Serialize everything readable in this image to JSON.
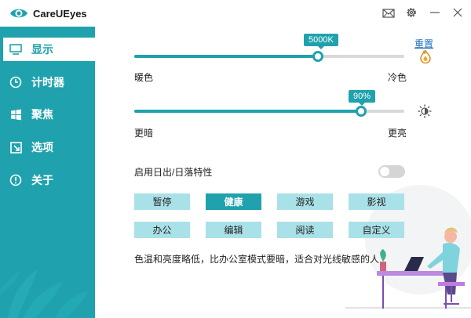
{
  "app": {
    "title": "CareUEyes"
  },
  "colors": {
    "accent": "#1fa2ad",
    "sidebar": "#1fa2ad",
    "button_bg": "#a9e1e8",
    "link": "#1a6fbf"
  },
  "titlebar_icons": [
    "mail-icon",
    "gear-icon",
    "minimize-icon",
    "close-icon"
  ],
  "sidebar": {
    "items": [
      {
        "label": "显示",
        "icon": "monitor-icon",
        "active": true
      },
      {
        "label": "计时器",
        "icon": "clock-icon",
        "active": false
      },
      {
        "label": "聚焦",
        "icon": "windows-icon",
        "active": false
      },
      {
        "label": "选项",
        "icon": "external-link-icon",
        "active": false
      },
      {
        "label": "关于",
        "icon": "info-icon",
        "active": false
      }
    ]
  },
  "display": {
    "reset_label": "重置",
    "temperature": {
      "value_text": "5000K",
      "min_label": "暖色",
      "max_label": "冷色",
      "level": 0.68,
      "icon": "flame-icon"
    },
    "brightness": {
      "value_text": "90%",
      "min_label": "更暗",
      "max_label": "更亮",
      "level": 0.84,
      "icon": "brightness-icon"
    },
    "sunset": {
      "label": "启用日出/日落特性",
      "enabled": false
    },
    "modes": [
      {
        "label": "暂停",
        "selected": false
      },
      {
        "label": "健康",
        "selected": true
      },
      {
        "label": "游戏",
        "selected": false
      },
      {
        "label": "影视",
        "selected": false
      },
      {
        "label": "办公",
        "selected": false
      },
      {
        "label": "编辑",
        "selected": false
      },
      {
        "label": "阅读",
        "selected": false
      },
      {
        "label": "自定义",
        "selected": false
      }
    ],
    "description": "色温和亮度略低，比办公室模式要暗，适合对光线敏感的人"
  }
}
